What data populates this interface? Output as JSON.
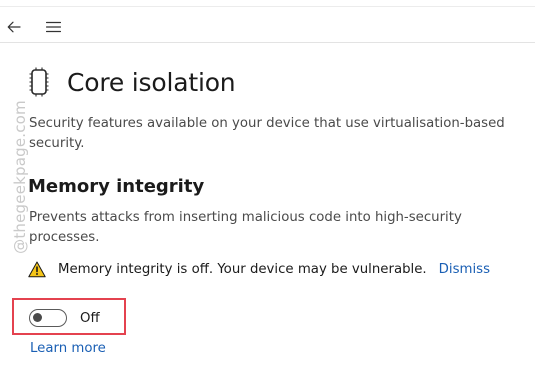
{
  "nav": {
    "back_icon": "back-arrow-icon",
    "menu_icon": "hamburger-menu-icon"
  },
  "watermark": {
    "text": "@thegeekpage.com"
  },
  "header": {
    "icon": "chip-icon",
    "title": "Core isolation"
  },
  "intro": {
    "description": "Security features available on your device that use virtualisation-based security."
  },
  "memory_integrity": {
    "heading": "Memory integrity",
    "description": "Prevents attacks from inserting malicious code into high-security processes.",
    "warning": {
      "icon": "warning-icon",
      "text": "Memory integrity is off. Your device may be vulnerable.",
      "dismiss_label": "Dismiss"
    },
    "toggle": {
      "state_label": "Off",
      "is_on": false
    },
    "learn_more_label": "Learn more"
  },
  "colors": {
    "accent_link": "#1a5fb4",
    "warning_fill": "#f5c518",
    "highlight_border": "#e4424f"
  }
}
